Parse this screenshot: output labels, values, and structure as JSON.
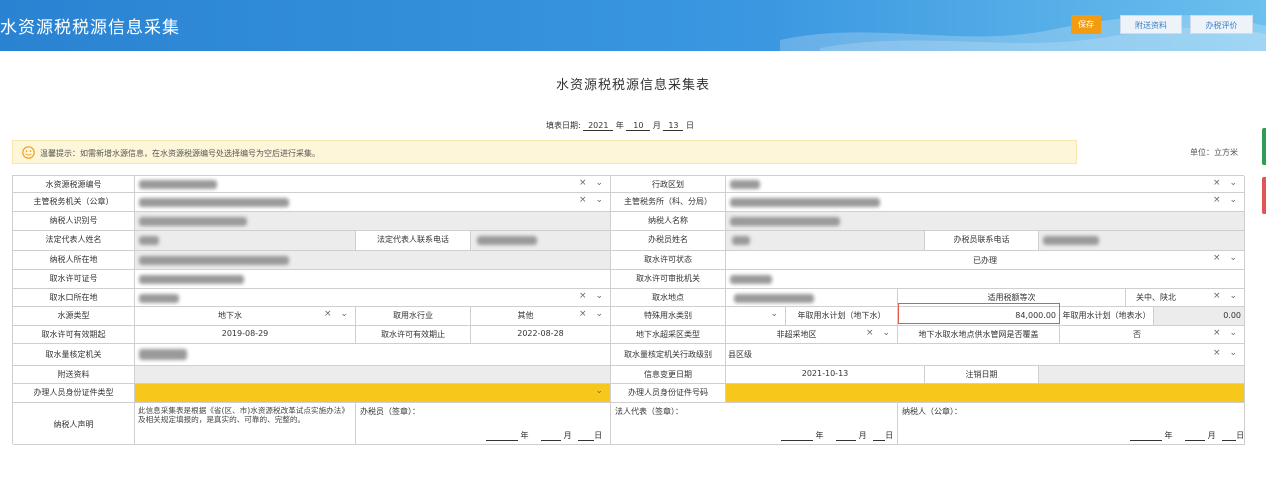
{
  "header": {
    "title": "水资源税税源信息采集",
    "buttons": {
      "save": "保存",
      "attach": "附送资料",
      "rate": "办税评价"
    }
  },
  "form": {
    "title": "水资源税税源信息采集表",
    "fill_date_label": "填表日期:",
    "fill_date": {
      "year": "2021",
      "year_unit": "年",
      "month": "10",
      "month_unit": "月",
      "day": "13",
      "day_unit": "日"
    }
  },
  "tip": "温馨提示：如需新增水源信息，在水资源税源编号处选择编号为空后进行采集。",
  "unit": "单位：立方米",
  "controls": {
    "clear_dropdown": "× ⌄",
    "dropdown": "⌄"
  },
  "rows": {
    "r1": {
      "label_left": "水资源税源编号",
      "label_right": "行政区划"
    },
    "r2": {
      "label_left": "主管税务机关（公章）",
      "label_right": "主管税务所（科、分局）"
    },
    "r3": {
      "label_left": "纳税人识别号",
      "label_right": "纳税人名称"
    },
    "r4": {
      "label_a": "法定代表人姓名",
      "label_b": "法定代表人联系电话",
      "label_c": "办税员姓名",
      "label_d": "办税员联系电话"
    },
    "r5": {
      "label_left": "纳税人所在地",
      "label_right": "取水许可状态",
      "value_right": "已办理"
    },
    "r6": {
      "label_left": "取水许可证号",
      "label_right": "取水许可审批机关"
    },
    "r7": {
      "label_left": "取水口所在地",
      "label_mid": "取水地点",
      "label_right": "适用税额等次",
      "value_right": "关中、陕北"
    },
    "r8": {
      "label_a": "水源类型",
      "value_a": "地下水",
      "label_b": "取用水行业",
      "value_b": "其他",
      "label_c": "特殊用水类别",
      "label_d": "年取用水计划（地下水）",
      "value_d": "84,000.00",
      "label_e": "年取用水计划（地表水）",
      "value_e": "0.00"
    },
    "r9": {
      "label_a": "取水许可有效期起",
      "value_a": "2019-08-29",
      "label_b": "取水许可有效期止",
      "value_b": "2022-08-28",
      "label_c": "地下水超采区类型",
      "value_c": "非超采地区",
      "label_d": "地下水取水地点供水管网是否覆盖",
      "value_d": "否"
    },
    "r10": {
      "label_left": "取水量核定机关",
      "label_right": "取水量核定机关行政级别",
      "value_right": "县区级"
    },
    "r11": {
      "label_left": "附送资料",
      "label_mid": "信息变更日期",
      "value_mid": "2021-10-13",
      "label_right": "注销日期"
    },
    "r12": {
      "label_left": "办理人员身份证件类型",
      "label_right": "办理人员身份证件号码"
    },
    "r13": {
      "label": "纳税人声明",
      "declaration": "此信息采集表是根据《省(区、市)水资源税改革试点实施办法》及相关规定填报的，是真实的、可靠的、完整的。",
      "clerk": "办税员（签章）：",
      "legal": "法人代表（签章）：",
      "taxpayer": "纳税人（公章）：",
      "year": "年",
      "month": "月",
      "day": "日"
    }
  }
}
